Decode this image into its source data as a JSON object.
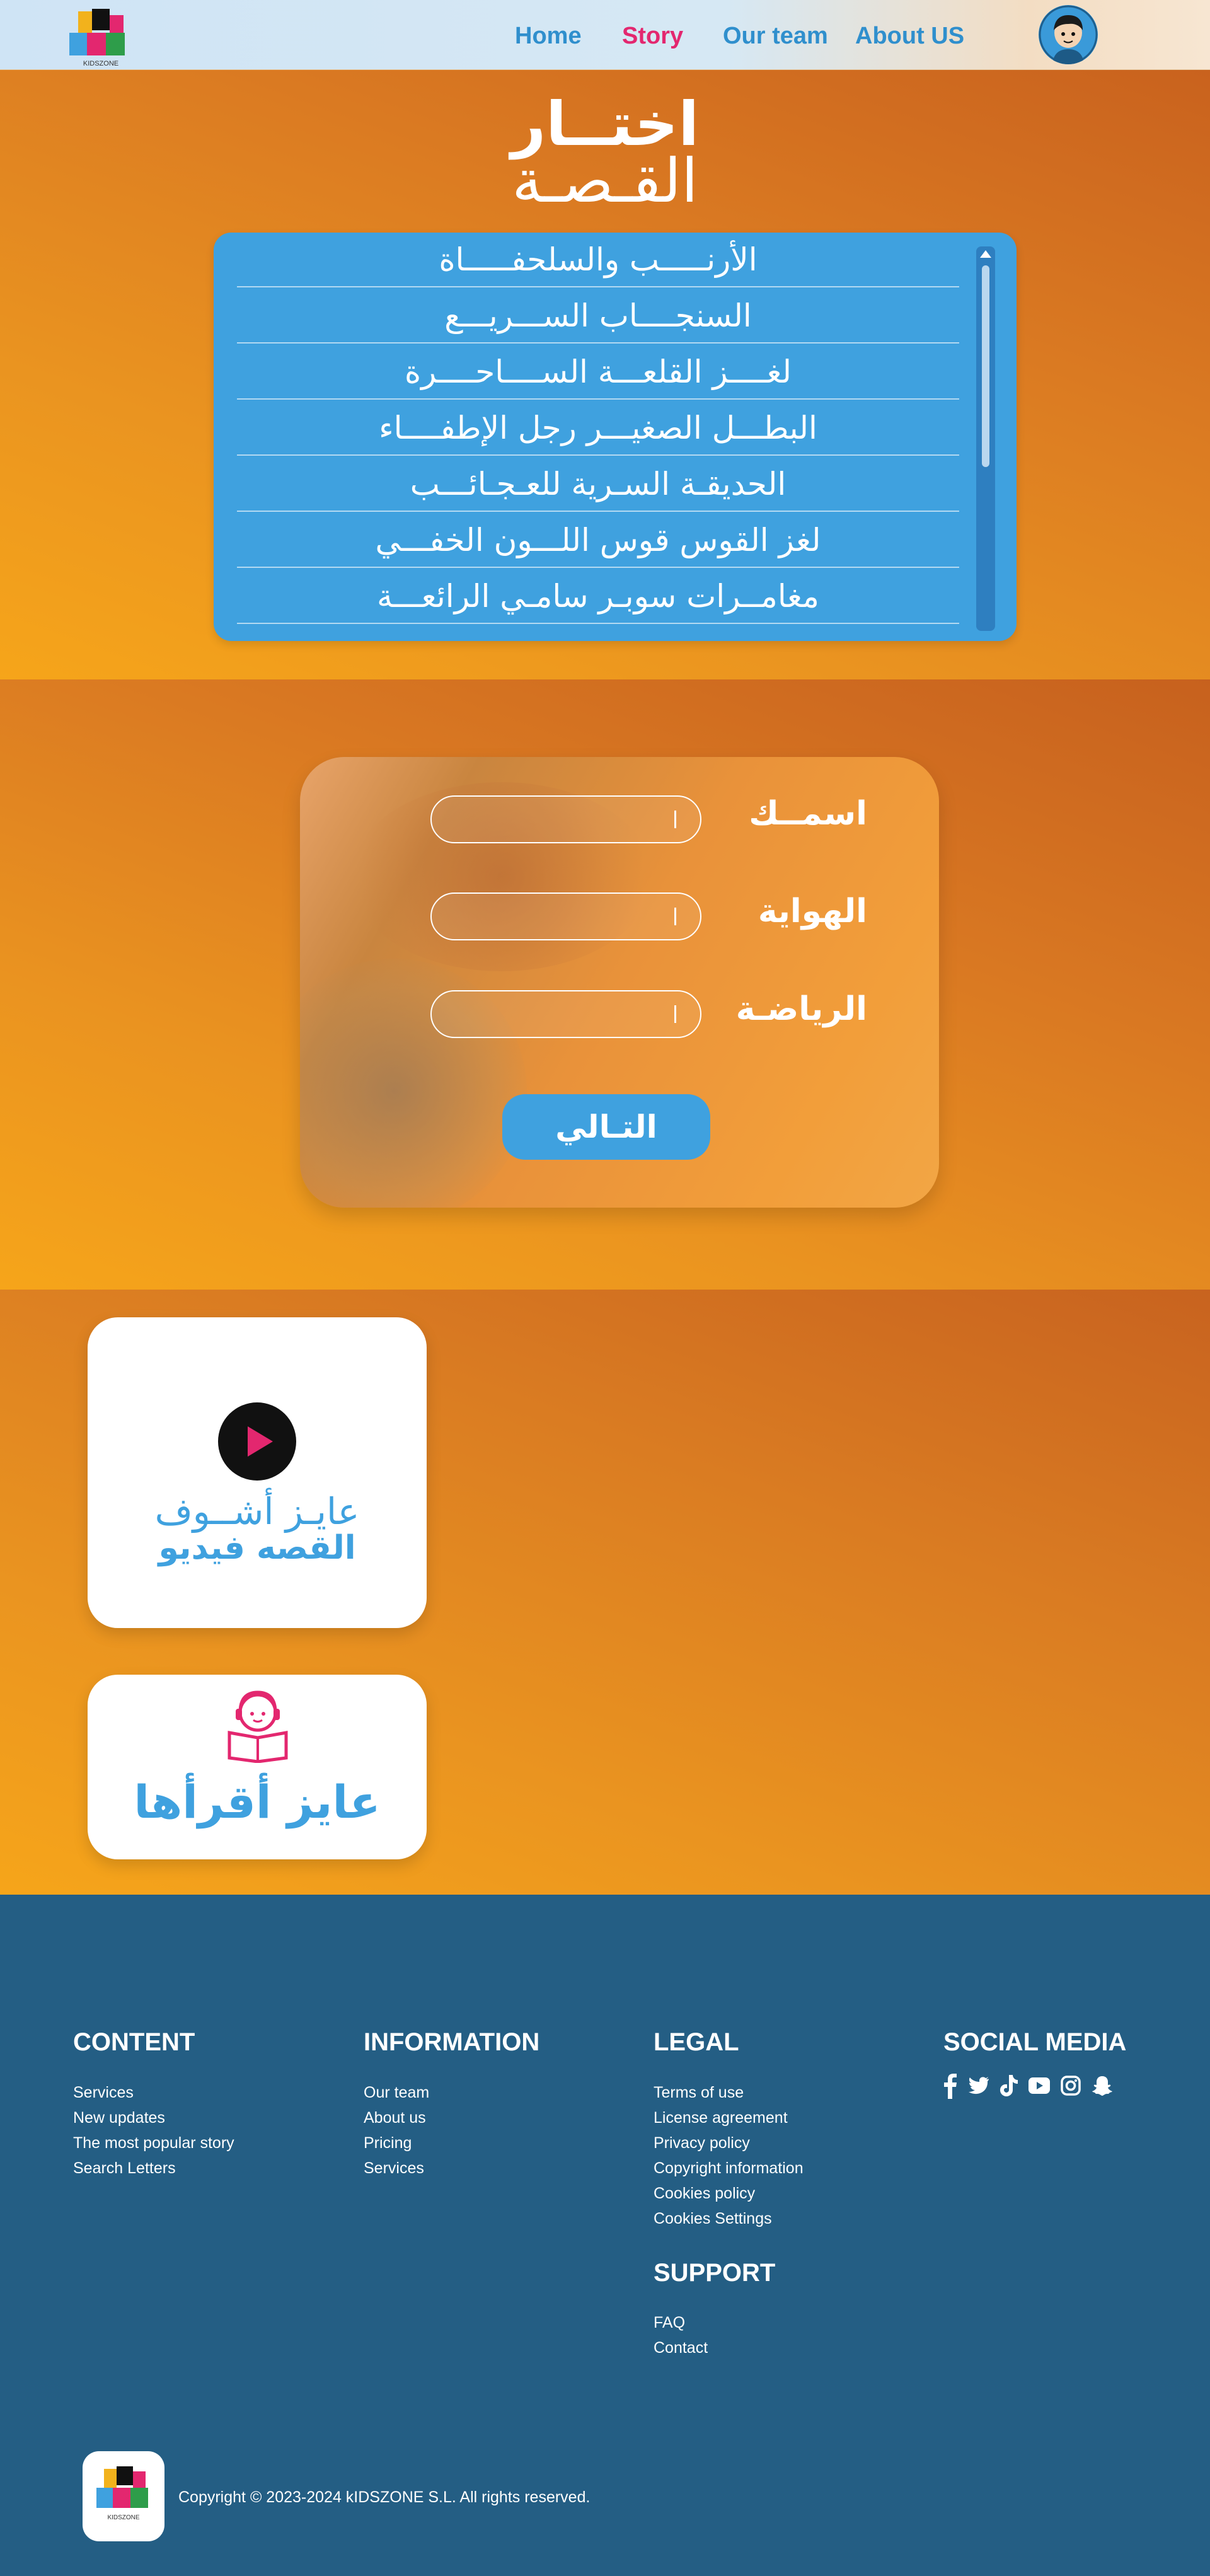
{
  "colors": {
    "accent_blue": "#3fa1df",
    "accent_pink": "#e3276f",
    "footer_bg": "#245e84",
    "orange": "#f3a11e"
  },
  "nav": {
    "logo_text": "KIDSZONE",
    "links": [
      {
        "label": "Home",
        "active": false
      },
      {
        "label": "Story",
        "active": true
      },
      {
        "label": "Our team",
        "active": false
      },
      {
        "label": "About US",
        "active": false
      }
    ],
    "avatar_icon": "user-avatar-icon"
  },
  "choose": {
    "title_bold": "اختــار",
    "title_light": "القـصـة",
    "stories": [
      "الأرنـــــب والسلحفـــــاة",
      "السنجــــاب الســـريـــع",
      "لغــــز القلعـــة الســــاحــــرة",
      "البطـــل الصغيـــر رجل الإطفــــاء",
      "الحديقـة السـرية للعـجـائـــب",
      "لغز القوس قوس اللـــون الخفـــي",
      "مغامــرات سوبـر سامـي الرائعـــة"
    ]
  },
  "form": {
    "fields": [
      {
        "label": "اسمــك",
        "value": "",
        "placeholder": ""
      },
      {
        "label": "الهواية",
        "value": "",
        "placeholder": ""
      },
      {
        "label": "الرياضـة",
        "value": "",
        "placeholder": ""
      }
    ],
    "next_label": "التـالي"
  },
  "choices": {
    "video_line1": "عايـز أشــوف",
    "video_line2": "القصه فيديو",
    "read_label": "عايز أقرأها",
    "play_icon": "play-icon",
    "reading_icon": "girl-reading-icon"
  },
  "footer": {
    "content": {
      "title": "CONTENT",
      "links": [
        "Services",
        "New updates",
        "The most popular story",
        "Search Letters"
      ]
    },
    "information": {
      "title": "INFORMATION",
      "links": [
        "Our team",
        "About us",
        "Pricing",
        "Services"
      ]
    },
    "legal": {
      "title": "LEGAL",
      "links": [
        "Terms of use",
        "License agreement",
        "Privacy policy",
        "Copyright information",
        "Cookies policy",
        "Cookies Settings"
      ]
    },
    "support": {
      "title": "SUPPORT",
      "links": [
        "FAQ",
        "Contact"
      ]
    },
    "social": {
      "title": "SOCIAL MEDIA",
      "icons": [
        "facebook-icon",
        "twitter-icon",
        "tiktok-icon",
        "youtube-icon",
        "instagram-icon",
        "snapchat-icon"
      ]
    },
    "logo_text": "KIDSZONE",
    "copyright": "Copyright © 2023-2024 kIDSZONE S.L. All rights reserved."
  }
}
